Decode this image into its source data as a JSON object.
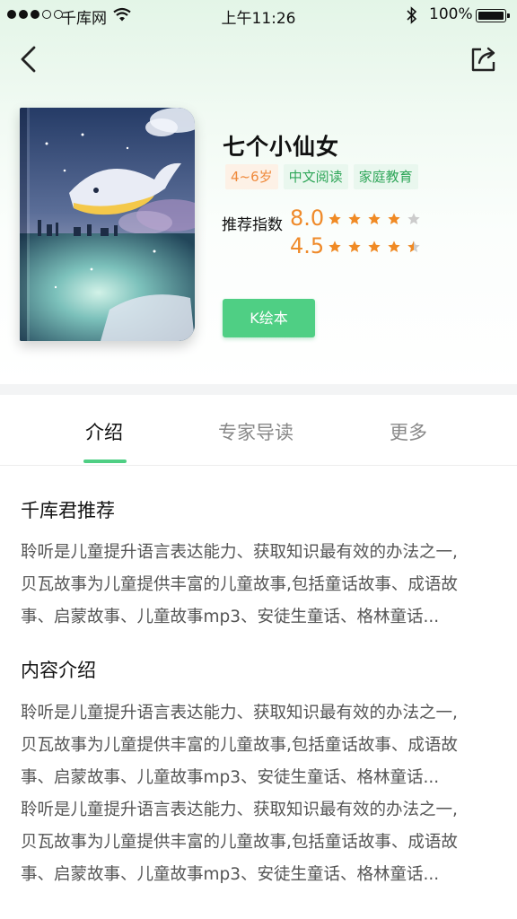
{
  "status_bar": {
    "carrier": "千库网",
    "time": "上午11:26",
    "battery": "100%"
  },
  "book": {
    "title": "七个小仙女",
    "tags": [
      "4~6岁",
      "中文阅读",
      "家庭教育"
    ],
    "rating_label": "推荐指数",
    "scores": [
      "8.0",
      "4.5"
    ],
    "stars": [
      4,
      4.5
    ],
    "action_label": "K绘本"
  },
  "tabs": [
    "介绍",
    "专家导读",
    "更多"
  ],
  "active_tab": "介绍",
  "sections": [
    {
      "title": "千库君推荐",
      "lines": [
        "聆听是儿童提升语言表达能力、获取知识最有效的办法之一,",
        "贝瓦故事为儿童提供丰富的儿童故事,包括童话故事、成语故",
        "事、启蒙故事、儿童故事mp3、安徒生童话、格林童话..."
      ]
    },
    {
      "title": "内容介绍",
      "lines": [
        "聆听是儿童提升语言表达能力、获取知识最有效的办法之一,",
        "贝瓦故事为儿童提供丰富的儿童故事,包括童话故事、成语故",
        "事、启蒙故事、儿童故事mp3、安徒生童话、格林童话...",
        "聆听是儿童提升语言表达能力、获取知识最有效的办法之一,",
        "贝瓦故事为儿童提供丰富的儿童故事,包括童话故事、成语故",
        "事、启蒙故事、儿童故事mp3、安徒生童话、格林童话..."
      ]
    }
  ],
  "colors": {
    "accent_green": "#4fcf84",
    "score_orange": "#ef8a2a",
    "star_orange": "#f08a24",
    "star_empty": "#cccccc"
  },
  "icons": [
    "signal-dots-icon",
    "wifi-icon",
    "bluetooth-icon",
    "battery-icon",
    "back-chevron-icon",
    "share-icon",
    "star-icon"
  ]
}
